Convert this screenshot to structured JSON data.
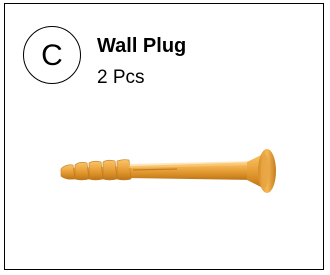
{
  "part": {
    "letter": "C",
    "name": "Wall Plug",
    "quantity": "2 Pcs",
    "image": "wall-plug-illustration",
    "color": "#e8a13a"
  }
}
